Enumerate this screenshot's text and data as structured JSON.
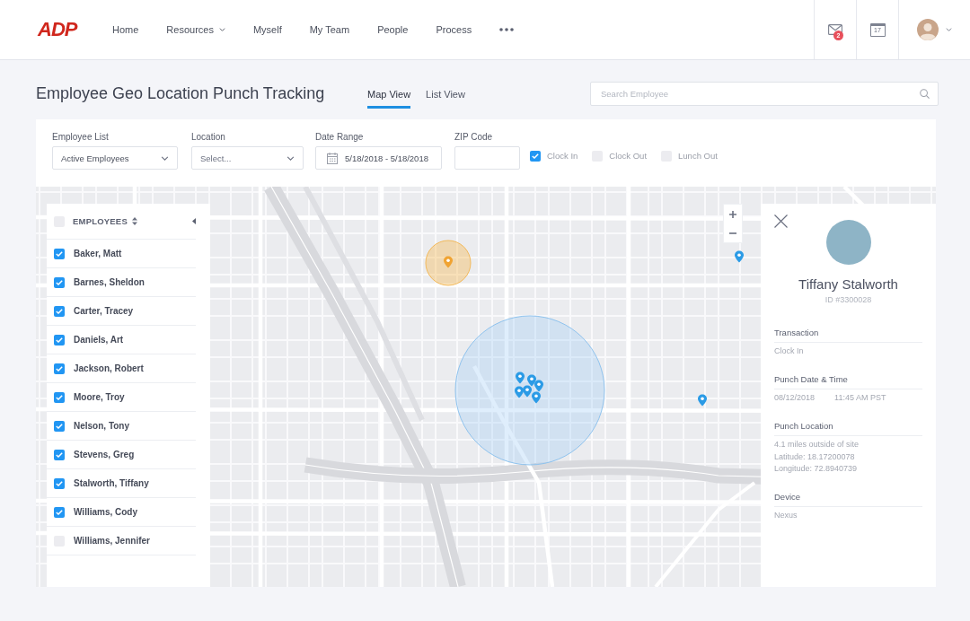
{
  "nav": {
    "logo": "ADP",
    "items": [
      {
        "label": "Home",
        "kind": "link"
      },
      {
        "label": "Resources",
        "kind": "dropdown"
      },
      {
        "label": "Myself",
        "kind": "link"
      },
      {
        "label": "My Team",
        "kind": "link"
      },
      {
        "label": "People",
        "kind": "link"
      },
      {
        "label": "Process",
        "kind": "link"
      }
    ],
    "notification_count": "2",
    "calendar_day": "17"
  },
  "header": {
    "title": "Employee Geo Location Punch Tracking",
    "tabs": [
      {
        "label": "Map View",
        "selected": true
      },
      {
        "label": "List View",
        "selected": false
      }
    ],
    "search": {
      "placeholder": "Search Employee"
    }
  },
  "filters": {
    "fields": [
      {
        "kind": "select",
        "label": "Employee List",
        "value": "Active Employees"
      },
      {
        "kind": "select",
        "label": "Location",
        "placeholder": "Select..."
      },
      {
        "kind": "date",
        "label": "Date Range",
        "value": "5/18/2018 - 5/18/2018"
      },
      {
        "kind": "text",
        "label": "ZIP Code"
      }
    ],
    "options": [
      {
        "label": "Clock In",
        "checked": true
      },
      {
        "label": "Clock Out",
        "checked": false
      },
      {
        "label": "Lunch Out",
        "checked": false
      }
    ]
  },
  "employees": {
    "heading": "EMPLOYEES",
    "all_checked": false,
    "items": [
      {
        "name": "Baker, Matt",
        "checked": true
      },
      {
        "name": "Barnes, Sheldon",
        "checked": true
      },
      {
        "name": "Carter, Tracey",
        "checked": true
      },
      {
        "name": "Daniels, Art",
        "checked": true
      },
      {
        "name": "Jackson, Robert",
        "checked": true
      },
      {
        "name": "Moore, Troy",
        "checked": true
      },
      {
        "name": "Nelson, Tony",
        "checked": true
      },
      {
        "name": "Stevens, Greg",
        "checked": true
      },
      {
        "name": "Stalworth, Tiffany",
        "checked": true
      },
      {
        "name": "Williams, Cody",
        "checked": true
      },
      {
        "name": "Williams, Jennifer",
        "checked": false
      }
    ]
  },
  "detail": {
    "name": "Tiffany Stalworth",
    "id": "ID #3300028",
    "sections": [
      {
        "label": "Transaction",
        "rows": [
          [
            "Clock In"
          ]
        ]
      },
      {
        "label": "Punch Date & Time",
        "rows": [
          [
            "08/12/2018",
            "11:45 AM PST"
          ]
        ]
      },
      {
        "label": "Punch Location",
        "rows": [
          [
            "4.1 miles outside of site"
          ],
          [
            "Latitude: 18.17200078"
          ],
          [
            "Longitude: 72.8940739"
          ]
        ]
      },
      {
        "label": "Device",
        "rows": [
          [
            "Nexus"
          ]
        ]
      }
    ]
  }
}
